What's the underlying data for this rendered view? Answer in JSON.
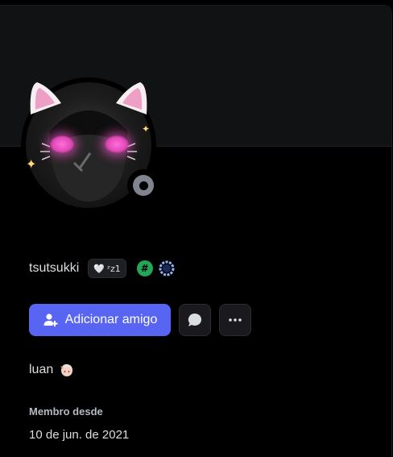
{
  "profile": {
    "username": "tsutsukki",
    "tag_emoji": "🤍",
    "tag_text": "ᶻz1",
    "badges": [
      "hash-badge",
      "ring-badge"
    ],
    "hash_symbol": "#",
    "status": "offline"
  },
  "actions": {
    "add_friend_label": "Adicionar amigo",
    "message_icon": "chat-bubble-icon",
    "more_icon": "ellipsis-icon"
  },
  "bio": {
    "text": "luan"
  },
  "member_since": {
    "label": "Membro desde",
    "date": "10 de jun. de 2021"
  },
  "colors": {
    "accent": "#5865f2",
    "badge_green": "#23a55a",
    "status_offline": "#80848e",
    "background": "#000000",
    "banner": "#111214"
  }
}
